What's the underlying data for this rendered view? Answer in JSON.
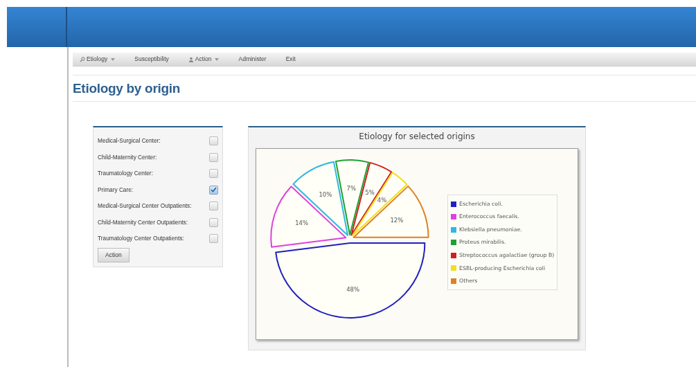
{
  "nav": [
    {
      "label": "Etiology",
      "kind": "dropdown"
    },
    {
      "label": "Susceptibility",
      "kind": "link"
    },
    {
      "label": "Action",
      "kind": "dropdown"
    },
    {
      "label": "Administer",
      "kind": "link"
    },
    {
      "label": "Exit",
      "kind": "link"
    }
  ],
  "page_title": "Etiology by origin",
  "origins": [
    {
      "label": "Medical-Surgical Center:",
      "checked": false
    },
    {
      "label": "Child-Maternity Center:",
      "checked": false
    },
    {
      "label": "Traumatology Center:",
      "checked": false
    },
    {
      "label": "Primary Care:",
      "checked": true
    },
    {
      "label": "Medical-Surgical Center Outpatients:",
      "checked": false
    },
    {
      "label": "Child-Maternity Center Outpatients:",
      "checked": false
    },
    {
      "label": "Traumatology Center Outpatients:",
      "checked": false
    }
  ],
  "action_button": "Action",
  "chart_panel": {
    "title": "Etiology for selected origins",
    "chart_data": {
      "type": "pie",
      "legend": "right",
      "categories": [
        "Escherichia coli.",
        "Enterococcus faecalis.",
        "Klebsiella pneumoniae.",
        "Proteus mirabilis.",
        "Streptococcus agalactiae (group B)",
        "ESBL-producing Escherichia coli",
        "Others"
      ],
      "values": [
        48,
        14,
        10,
        7,
        5,
        4,
        12
      ],
      "value_labels": [
        "48%",
        "14%",
        "10%",
        "7%",
        "5%",
        "4%",
        "12%"
      ],
      "colors": [
        "#2020c0",
        "#e040e0",
        "#30b8e0",
        "#20a030",
        "#d02020",
        "#f0e020",
        "#e08020"
      ]
    }
  }
}
